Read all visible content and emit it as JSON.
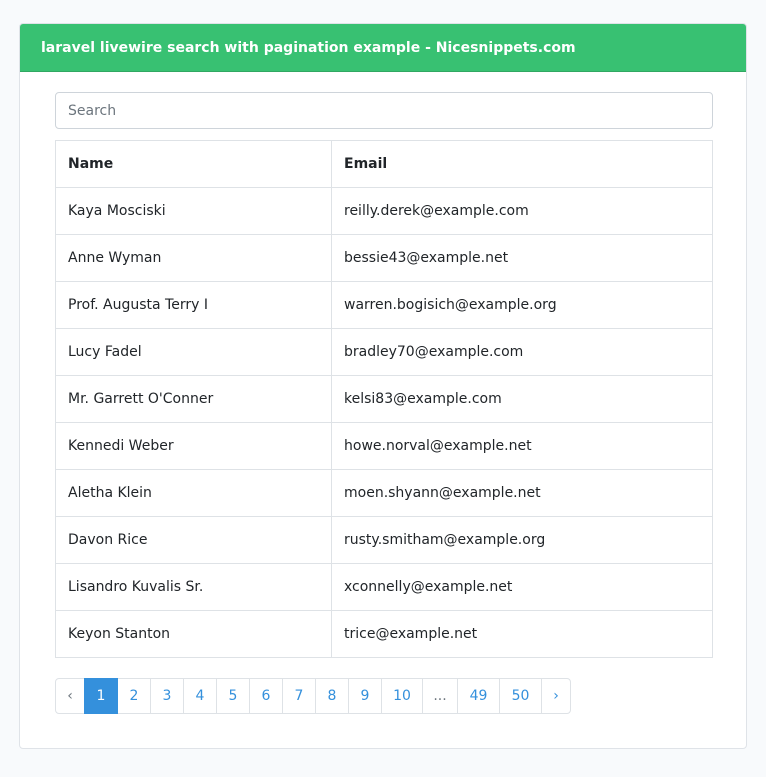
{
  "header": {
    "title": "laravel livewire search with pagination example - Nicesnippets.com"
  },
  "search": {
    "placeholder": "Search",
    "value": ""
  },
  "table": {
    "columns": [
      "Name",
      "Email"
    ],
    "rows": [
      [
        "Kaya Mosciski",
        "reilly.derek@example.com"
      ],
      [
        "Anne Wyman",
        "bessie43@example.net"
      ],
      [
        "Prof. Augusta Terry I",
        "warren.bogisich@example.org"
      ],
      [
        "Lucy Fadel",
        "bradley70@example.com"
      ],
      [
        "Mr. Garrett O'Conner",
        "kelsi83@example.com"
      ],
      [
        "Kennedi Weber",
        "howe.norval@example.net"
      ],
      [
        "Aletha Klein",
        "moen.shyann@example.net"
      ],
      [
        "Davon Rice",
        "rusty.smitham@example.org"
      ],
      [
        "Lisandro Kuvalis Sr.",
        "xconnelly@example.net"
      ],
      [
        "Keyon Stanton",
        "trice@example.net"
      ]
    ]
  },
  "pagination": {
    "prev": "‹",
    "next": "›",
    "current": "1",
    "pages": [
      "1",
      "2",
      "3",
      "4",
      "5",
      "6",
      "7",
      "8",
      "9",
      "10",
      "...",
      "49",
      "50"
    ]
  },
  "colors": {
    "header": "#38c172",
    "accent": "#3490dc"
  }
}
